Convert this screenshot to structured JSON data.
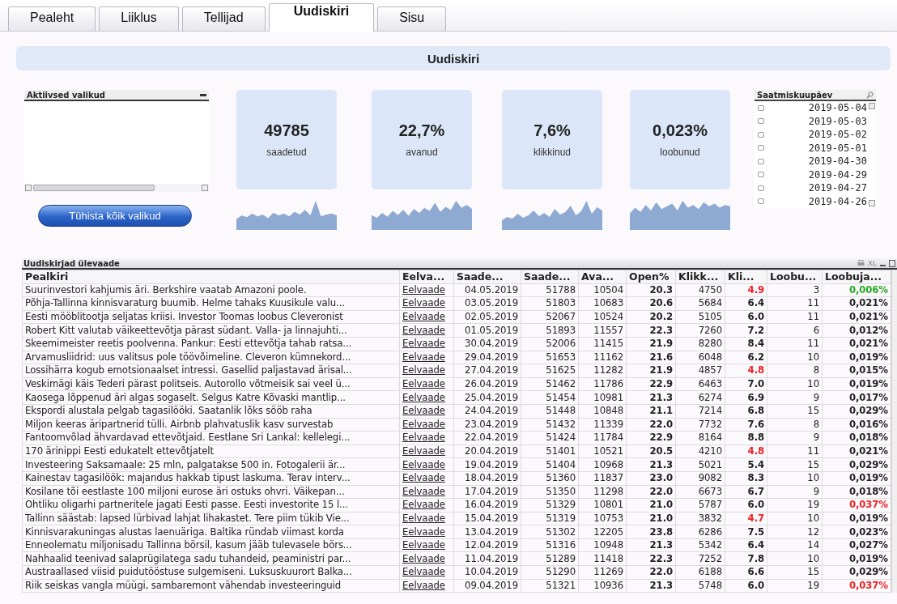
{
  "tabs": [
    {
      "label": "Pealeht",
      "selected": false
    },
    {
      "label": "Liiklus",
      "selected": false
    },
    {
      "label": "Tellijad",
      "selected": false
    },
    {
      "label": "Uudiskiri",
      "selected": true
    },
    {
      "label": "Sisu",
      "selected": false
    }
  ],
  "banner": {
    "title": "Uudiskiri"
  },
  "active_selections": {
    "title": "Aktiivsed valikud",
    "button": "Tühista kõik valikud"
  },
  "kpis": [
    {
      "value": "49785",
      "label": "saadetud"
    },
    {
      "value": "22,7%",
      "label": "avanud"
    },
    {
      "value": "7,6%",
      "label": "klikkinud"
    },
    {
      "value": "0,023%",
      "label": "loobunud"
    }
  ],
  "date_list": {
    "title": "Saatmiskuupäev",
    "items": [
      {
        "label": "2019-05-04",
        "selected": false
      },
      {
        "label": "2019-05-03",
        "selected": false
      },
      {
        "label": "2019-05-02",
        "selected": false
      },
      {
        "label": "2019-05-01",
        "selected": false
      },
      {
        "label": "2019-04-30",
        "selected": false
      },
      {
        "label": "2019-04-29",
        "selected": false
      },
      {
        "label": "2019-04-27",
        "selected": false
      },
      {
        "label": "2019-04-26",
        "selected": false
      }
    ]
  },
  "table": {
    "title": "Uudiskirjad ülevaade",
    "toolbar": "XL",
    "columns": [
      "Pealkiri",
      "Eelva...",
      "Saade...",
      "Saade...",
      "Ava...",
      "Open%",
      "Klikk...",
      "Kli...",
      "Loobu...",
      "Loobuja..."
    ],
    "rows": [
      {
        "cells": [
          "Suurinvestori kahjumis äri. Berkshire vaatab Amazoni poole.",
          "Eelvaade",
          "04.05.2019",
          "51788",
          "10504",
          "20.3",
          "4750",
          "4.9",
          "3",
          "0,006%"
        ],
        "click_alert": true,
        "unsub_alert": false,
        "unsub_good": true
      },
      {
        "cells": [
          "Põhja-Tallinna kinnisvaraturg buumib. Helme tahaks Kuusikule valu...",
          "Eelvaade",
          "03.05.2019",
          "51803",
          "10683",
          "20.6",
          "5684",
          "6.4",
          "11",
          "0,021%"
        ],
        "click_alert": false,
        "unsub_alert": false,
        "unsub_good": false
      },
      {
        "cells": [
          "Eesti mööblitootja seljatas kriisi. Investor Toomas loobus Cleveronist",
          "Eelvaade",
          "02.05.2019",
          "52067",
          "10524",
          "20.2",
          "5105",
          "6.0",
          "11",
          "0,021%"
        ],
        "click_alert": false,
        "unsub_alert": false,
        "unsub_good": false
      },
      {
        "cells": [
          "Robert Kitt valutab väikeettevõtja pärast südant. Valla- ja linnajuhti...",
          "Eelvaade",
          "01.05.2019",
          "51893",
          "11557",
          "22.3",
          "7260",
          "7.2",
          "6",
          "0,012%"
        ],
        "click_alert": false,
        "unsub_alert": false,
        "unsub_good": false
      },
      {
        "cells": [
          "Skeemimeister reetis poolvenna. Pankur: Eesti ettevõtja tahab ratsa...",
          "Eelvaade",
          "30.04.2019",
          "52006",
          "11415",
          "21.9",
          "8280",
          "8.4",
          "11",
          "0,021%"
        ],
        "click_alert": false,
        "unsub_alert": false,
        "unsub_good": false
      },
      {
        "cells": [
          "Arvamusliidrid: uus valitsus pole töövõimeline. Cleveron kümnekord...",
          "Eelvaade",
          "29.04.2019",
          "51653",
          "11162",
          "21.6",
          "6048",
          "6.2",
          "10",
          "0,019%"
        ],
        "click_alert": false,
        "unsub_alert": false,
        "unsub_good": false
      },
      {
        "cells": [
          "Lossihärra kogub emotsionaalset intressi. Gasellid paljastavad ärisal...",
          "Eelvaade",
          "27.04.2019",
          "51625",
          "11282",
          "21.9",
          "4857",
          "4.8",
          "8",
          "0,015%"
        ],
        "click_alert": true,
        "unsub_alert": false,
        "unsub_good": false
      },
      {
        "cells": [
          "Veskimägi käis Tederi pärast politseis. Autorollo võtmeisik sai veel ü...",
          "Eelvaade",
          "26.04.2019",
          "51462",
          "11786",
          "22.9",
          "6463",
          "7.0",
          "10",
          "0,019%"
        ],
        "click_alert": false,
        "unsub_alert": false,
        "unsub_good": false
      },
      {
        "cells": [
          "Kaosega lõppenud äri algas sogaselt. Selgus Katre Kõvaski mantlip...",
          "Eelvaade",
          "25.04.2019",
          "51454",
          "10981",
          "21.3",
          "6274",
          "6.9",
          "9",
          "0,017%"
        ],
        "click_alert": false,
        "unsub_alert": false,
        "unsub_good": false
      },
      {
        "cells": [
          "Ekspordi alustala pelgab tagasilööki. Saatanlik lõks sööb raha",
          "Eelvaade",
          "24.04.2019",
          "51448",
          "10848",
          "21.1",
          "7214",
          "6.8",
          "15",
          "0,029%"
        ],
        "click_alert": false,
        "unsub_alert": false,
        "unsub_good": false
      },
      {
        "cells": [
          "Miljon keeras äripartnerid tülli. Airbnb plahvatuslik kasv survestab",
          "Eelvaade",
          "23.04.2019",
          "51432",
          "11339",
          "22.0",
          "7732",
          "7.6",
          "8",
          "0,016%"
        ],
        "click_alert": false,
        "unsub_alert": false,
        "unsub_good": false
      },
      {
        "cells": [
          "Fantoomvõlad ähvardavad ettevõtjaid. Eestlane Sri Lankal: kellelegi...",
          "Eelvaade",
          "22.04.2019",
          "51424",
          "11784",
          "22.9",
          "8164",
          "8.8",
          "9",
          "0,018%"
        ],
        "click_alert": false,
        "unsub_alert": false,
        "unsub_good": false
      },
      {
        "cells": [
          "170 ärinippi Eesti edukatelt ettevõtjatelt",
          "Eelvaade",
          "20.04.2019",
          "51401",
          "10521",
          "20.5",
          "4210",
          "4.8",
          "11",
          "0,021%"
        ],
        "click_alert": true,
        "unsub_alert": false,
        "unsub_good": false
      },
      {
        "cells": [
          "Investeering Saksamaale: 25 mln, palgatakse 500 in. Fotogalerii är...",
          "Eelvaade",
          "19.04.2019",
          "51404",
          "10968",
          "21.3",
          "5021",
          "5.4",
          "15",
          "0,029%"
        ],
        "click_alert": false,
        "unsub_alert": false,
        "unsub_good": false
      },
      {
        "cells": [
          "Kainestav tagasilöök: majandus hakkab tipust laskuma. Terav interv...",
          "Eelvaade",
          "18.04.2019",
          "51360",
          "11837",
          "23.0",
          "9082",
          "8.3",
          "10",
          "0,019%"
        ],
        "click_alert": false,
        "unsub_alert": false,
        "unsub_good": false
      },
      {
        "cells": [
          "Kosilane tõi eestlaste 100 miljoni eurose äri ostuks ohvri.  Väikepan...",
          "Eelvaade",
          "17.04.2019",
          "51350",
          "11298",
          "22.0",
          "6673",
          "6.7",
          "9",
          "0,018%"
        ],
        "click_alert": false,
        "unsub_alert": false,
        "unsub_good": false
      },
      {
        "cells": [
          "Ohtliku oligarhi partneritele jagati Eesti passe. Eesti investorite 15 l...",
          "Eelvaade",
          "16.04.2019",
          "51329",
          "10801",
          "21.0",
          "5787",
          "6.0",
          "19",
          "0,037%"
        ],
        "click_alert": false,
        "unsub_alert": true,
        "unsub_good": false
      },
      {
        "cells": [
          "Tallinn säästab: lapsed lürbivad lahjat lihakastet. Tere piim tükib Vie...",
          "Eelvaade",
          "15.04.2019",
          "51319",
          "10753",
          "21.0",
          "3832",
          "4.7",
          "10",
          "0,019%"
        ],
        "click_alert": true,
        "unsub_alert": false,
        "unsub_good": false
      },
      {
        "cells": [
          "Kinnisvarakuningas alustas laenuäriga. Baltika ründab viimast korda",
          "Eelvaade",
          "13.04.2019",
          "51302",
          "12205",
          "23.8",
          "6286",
          "7.5",
          "12",
          "0,023%"
        ],
        "click_alert": false,
        "unsub_alert": false,
        "unsub_good": false
      },
      {
        "cells": [
          "Enneolematu miljonisadu Tallinna börsil, kasum jääb tulevasele börs...",
          "Eelvaade",
          "12.04.2019",
          "51316",
          "10948",
          "21.3",
          "5342",
          "6.4",
          "14",
          "0,027%"
        ],
        "click_alert": false,
        "unsub_alert": false,
        "unsub_good": false
      },
      {
        "cells": [
          "Nahhaalid teenivad salaprügilatega sadu tuhandeid, peaministri par...",
          "Eelvaade",
          "11.04.2019",
          "51289",
          "11418",
          "22.3",
          "7252",
          "7.8",
          "10",
          "0,019%"
        ],
        "click_alert": false,
        "unsub_alert": false,
        "unsub_good": false
      },
      {
        "cells": [
          "Austraallased viisid puidutööstuse sulgemiseni. Luksuskuurort Balka...",
          "Eelvaade",
          "10.04.2019",
          "51290",
          "11269",
          "22.0",
          "6188",
          "6.6",
          "15",
          "0,029%"
        ],
        "click_alert": false,
        "unsub_alert": false,
        "unsub_good": false
      },
      {
        "cells": [
          "Riik seiskas vangla müügi, sambaremont vähendab investeeringuid",
          "Eelvaade",
          "09.04.2019",
          "51321",
          "10936",
          "21.3",
          "5748",
          "6.0",
          "19",
          "0,037%"
        ],
        "click_alert": false,
        "unsub_alert": true,
        "unsub_good": false
      }
    ]
  }
}
